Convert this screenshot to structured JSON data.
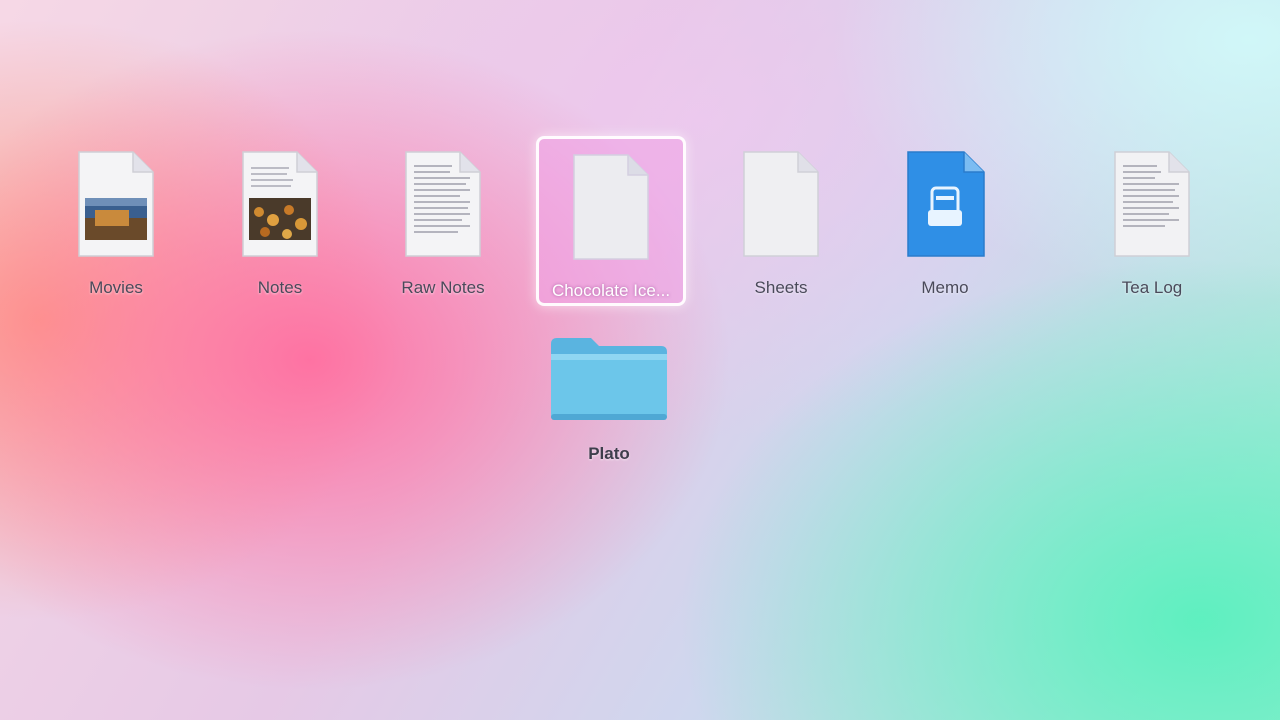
{
  "desktop": {
    "files": [
      {
        "label": "Movies",
        "kind": "image-doc",
        "icon": "photo-document-icon",
        "thumb_colors": [
          "#3a5f8f",
          "#c98a3c"
        ]
      },
      {
        "label": "Notes",
        "kind": "image-doc",
        "icon": "photo-document-icon",
        "thumb_colors": [
          "#4a3a2a",
          "#d08a30"
        ]
      },
      {
        "label": "Raw Notes",
        "kind": "text-doc",
        "icon": "text-document-icon"
      },
      {
        "label": "Chocolate Ice...",
        "kind": "blank-doc",
        "icon": "blank-document-icon",
        "selected": true
      },
      {
        "label": "Sheets",
        "kind": "blank-doc",
        "icon": "blank-document-icon"
      },
      {
        "label": "Memo",
        "kind": "app-doc",
        "icon": "blue-app-document-icon"
      },
      {
        "label": "Tea Log",
        "kind": "text-doc",
        "icon": "text-document-icon"
      }
    ],
    "folders": [
      {
        "label": "Plato",
        "icon": "folder-icon"
      }
    ]
  },
  "colors": {
    "selection_fill": "#f0a0e6",
    "folder_blue": "#6cc6ea",
    "app_doc_blue": "#2f8fe6"
  }
}
